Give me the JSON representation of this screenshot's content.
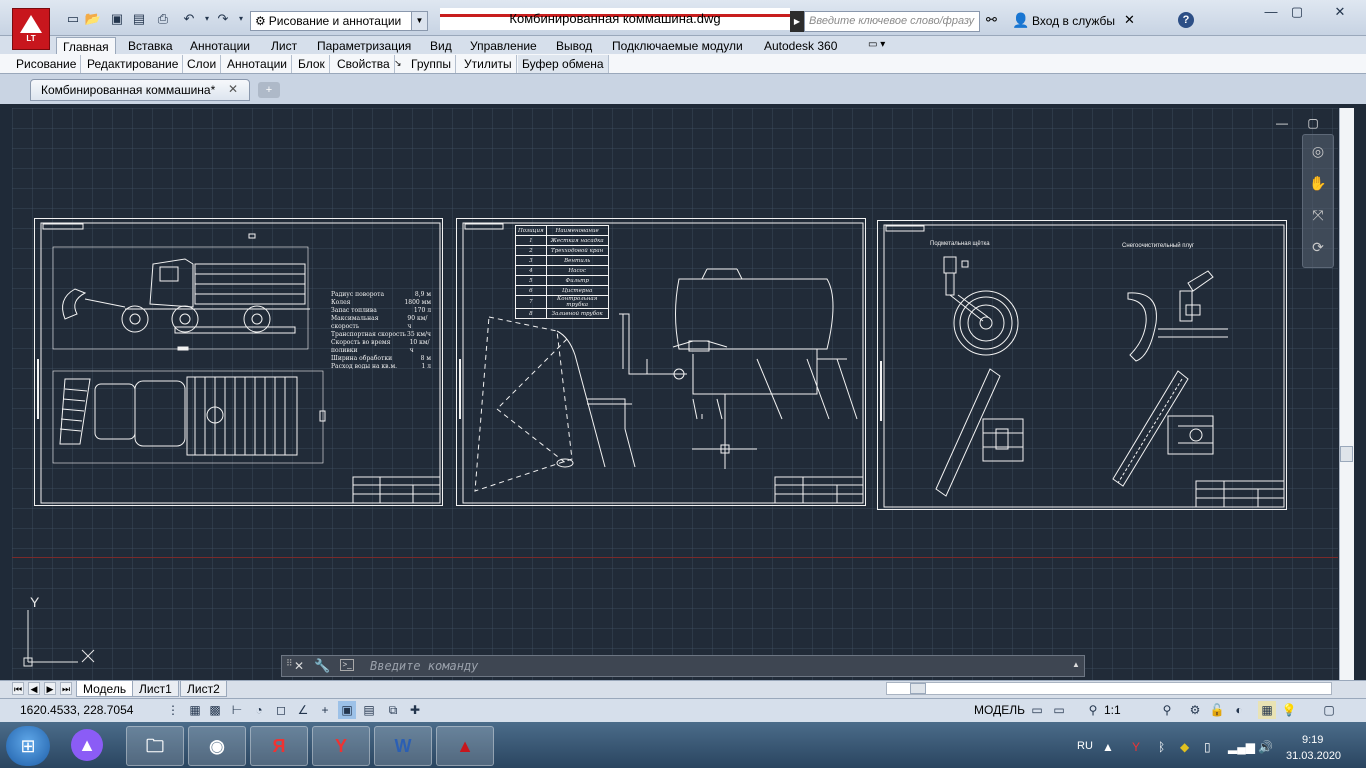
{
  "titlebar": {
    "document_title": "Комбинированная коммашина.dwg",
    "workspace": "Рисование и аннотации",
    "search_placeholder": "Введите ключевое слово/фразу",
    "login": "Вход в службы",
    "logo_text": "LT"
  },
  "ribbon": {
    "tabs": [
      "Главная",
      "Вставка",
      "Аннотации",
      "Лист",
      "Параметризация",
      "Вид",
      "Управление",
      "Вывод",
      "Подключаемые модули",
      "Autodesk 360"
    ],
    "active_tab": "Главная",
    "panels": [
      "Рисование",
      "Редактирование",
      "Слои",
      "Аннотации",
      "Блок",
      "Свойства",
      "Группы",
      "Утилиты",
      "Буфер обмена"
    ]
  },
  "file_tab": {
    "label": "Комбинированная коммашина*"
  },
  "drawing": {
    "sheet1_specs": [
      [
        "Радиус поворота",
        "8,9 м"
      ],
      [
        "Колея",
        "1800 мм"
      ],
      [
        "Запас топлива",
        "170 л"
      ],
      [
        "Максимальная скорость",
        "90 км/ч"
      ],
      [
        "Транспортная скорость",
        "35 км/ч"
      ],
      [
        "Скорость во время поливки",
        "10 км/ч"
      ],
      [
        "Ширина обработки",
        "8 м"
      ],
      [
        "Расход воды на кв.м.",
        "1 л"
      ]
    ],
    "sheet2_table": {
      "headers": [
        "Позиция",
        "Наименование"
      ],
      "rows": [
        [
          "1",
          "Жесткая насадка"
        ],
        [
          "2",
          "Трехходовой кран"
        ],
        [
          "3",
          "Вентиль"
        ],
        [
          "4",
          "Насос"
        ],
        [
          "5",
          "Фильтр"
        ],
        [
          "6",
          "Цистерна"
        ],
        [
          "7",
          "Контрольная трубка"
        ],
        [
          "8",
          "Заливной трубок"
        ]
      ]
    },
    "sheet3_labels": {
      "brush": "Подметальная щётка",
      "plow": "Снегоочистительный плуг"
    }
  },
  "ucs": {
    "y": "Y"
  },
  "command_line": {
    "placeholder": "Введите команду"
  },
  "layout_tabs": [
    "Модель",
    "Лист1",
    "Лист2"
  ],
  "status": {
    "coords": "1620.4533, 228.7054",
    "model": "МОДЕЛЬ",
    "scale": "1:1"
  },
  "taskbar": {
    "lang": "RU",
    "time": "9:19",
    "date": "31.03.2020"
  },
  "colors": {
    "canvas": "#212b38",
    "linework": "#f2f2f2",
    "accent_red": "#c8161d"
  }
}
